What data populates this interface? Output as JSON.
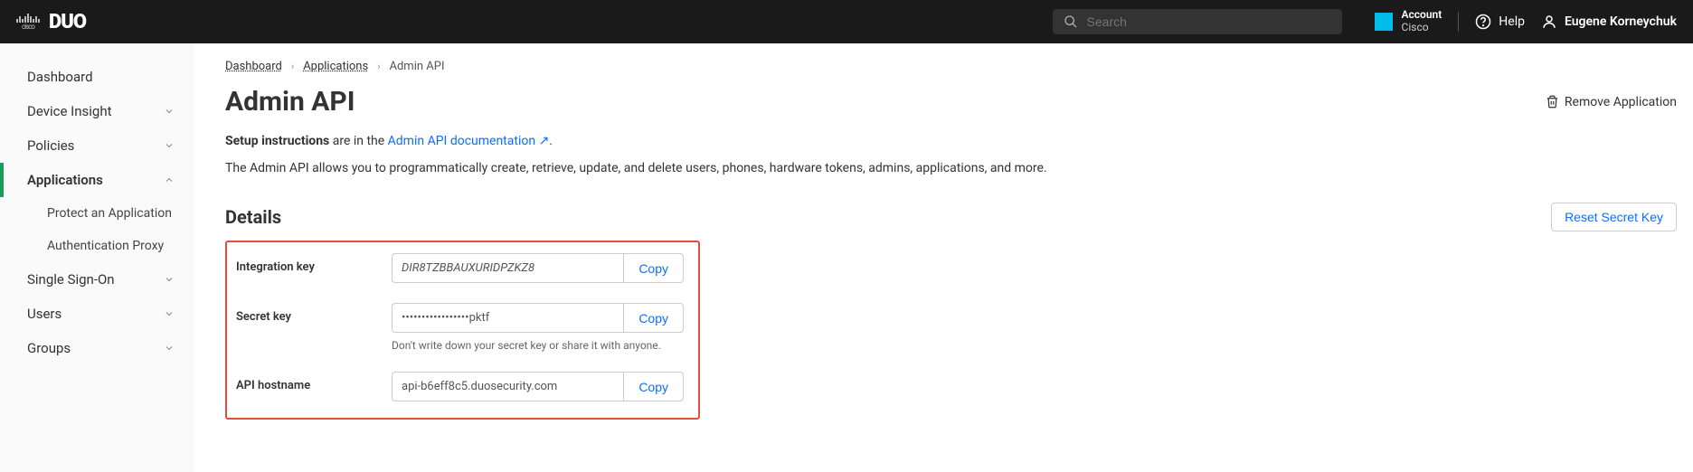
{
  "header": {
    "cisco": "cisco",
    "search_placeholder": "Search",
    "account_label": "Account",
    "account_sub": "Cisco",
    "help_label": "Help",
    "user_name": "Eugene Korneychuk"
  },
  "sidebar": {
    "dashboard": "Dashboard",
    "device_insight": "Device Insight",
    "policies": "Policies",
    "applications": "Applications",
    "protect_app": "Protect an Application",
    "auth_proxy": "Authentication Proxy",
    "sso": "Single Sign-On",
    "users": "Users",
    "groups": "Groups"
  },
  "breadcrumbs": {
    "dashboard": "Dashboard",
    "applications": "Applications",
    "current": "Admin API"
  },
  "page": {
    "title": "Admin API",
    "remove_app": "Remove Application",
    "setup_bold": "Setup instructions",
    "setup_rest": " are in the ",
    "setup_link": "Admin API documentation",
    "setup_link_icon": "↗",
    "setup_period": ".",
    "description": "The Admin API allows you to programmatically create, retrieve, update, and delete users, phones, hardware tokens, admins, applications, and more."
  },
  "details": {
    "heading": "Details",
    "reset_secret": "Reset Secret Key",
    "copy_label": "Copy",
    "integration_key_label": "Integration key",
    "integration_key_value": "DIR8TZBBAUXURIDPZKZ8",
    "secret_key_label": "Secret key",
    "secret_key_value": "•••••••••••••••••pktf",
    "secret_key_hint": "Don't write down your secret key or share it with anyone.",
    "api_hostname_label": "API hostname",
    "api_hostname_value": "api-b6eff8c5.duosecurity.com"
  }
}
